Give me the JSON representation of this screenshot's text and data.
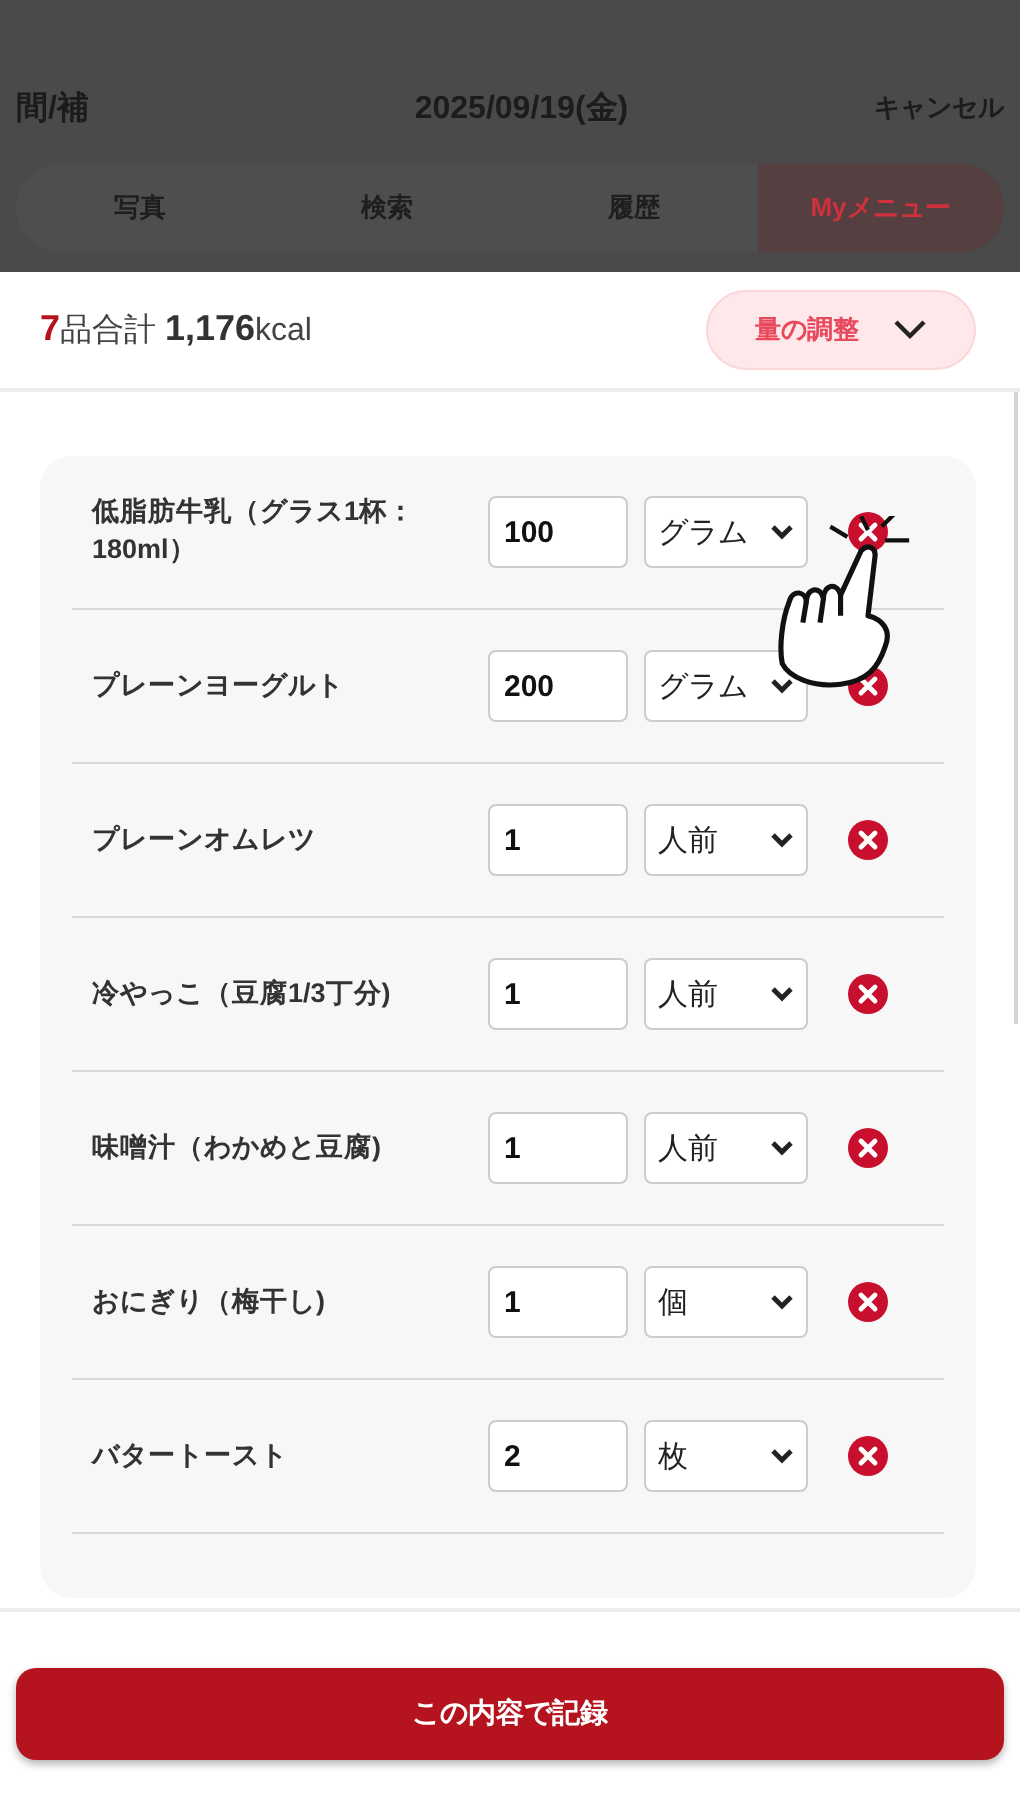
{
  "header": {
    "meal": "間/補",
    "date": "2025/09/19(金)",
    "cancel": "キャンセル"
  },
  "tabs": [
    {
      "label": "写真",
      "selected": false
    },
    {
      "label": "検索",
      "selected": false
    },
    {
      "label": "履歴",
      "selected": false
    },
    {
      "label": "Myメニュー",
      "selected": true
    }
  ],
  "summary": {
    "count": "7",
    "label": "品合計",
    "total": "1,176",
    "unit": "kcal"
  },
  "adjust_button": "量の調整",
  "items": [
    {
      "name": "低脂肪牛乳（グラス1杯：180ml）",
      "amount": "100",
      "unit": "グラム"
    },
    {
      "name": "プレーンヨーグルト",
      "amount": "200",
      "unit": "グラム"
    },
    {
      "name": "プレーンオムレツ",
      "amount": "1",
      "unit": "人前"
    },
    {
      "name": "冷やっこ（豆腐1/3丁分)",
      "amount": "1",
      "unit": "人前"
    },
    {
      "name": "味噌汁（わかめと豆腐)",
      "amount": "1",
      "unit": "人前"
    },
    {
      "name": "おにぎり（梅干し)",
      "amount": "1",
      "unit": "個"
    },
    {
      "name": "バタートースト",
      "amount": "2",
      "unit": "枚"
    }
  ],
  "record_button": "この内容で記録"
}
